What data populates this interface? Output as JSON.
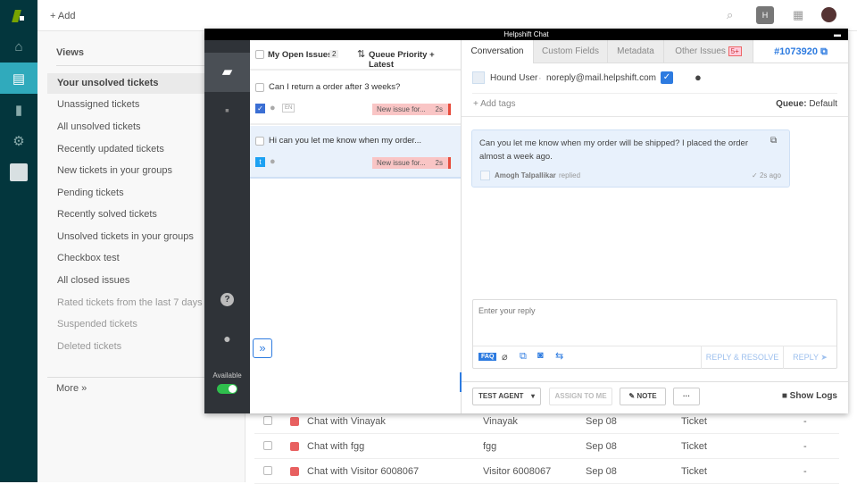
{
  "topbar": {
    "add_label": "+ Add"
  },
  "views": {
    "title": "Views",
    "items": [
      "Your unsolved tickets",
      "Unassigned tickets",
      "All unsolved tickets",
      "Recently updated tickets",
      "New tickets in your groups",
      "Pending tickets",
      "Recently solved tickets",
      "Unsolved tickets in your groups",
      "Checkbox test",
      "All closed issues",
      "Rated tickets from the last 7 days",
      "Suspended tickets",
      "Deleted tickets"
    ],
    "more": "More »"
  },
  "tickets": [
    {
      "subject": "Chat with Vinayak",
      "requester": "Vinayak",
      "date": "Sep 08",
      "type": "Ticket",
      "extra": "-"
    },
    {
      "subject": "Chat with fgg",
      "requester": "fgg",
      "date": "Sep 08",
      "type": "Ticket",
      "extra": "-"
    },
    {
      "subject": "Chat with Visitor 6008067",
      "requester": "Visitor 6008067",
      "date": "Sep 08",
      "type": "Ticket",
      "extra": "-"
    }
  ],
  "chat": {
    "title": "Helpshift Chat",
    "rail": {
      "available_label": "Available",
      "available": true
    },
    "list": {
      "my_open_label": "My Open Issues",
      "my_open_count": "2",
      "sort_label": "Queue Priority + Latest",
      "issues": [
        {
          "title": "Can I return a order after 3 weeks?",
          "lang": "EN",
          "status": "New issue for...",
          "age": "2s"
        },
        {
          "title": "Hi can you let me know when my order...",
          "status": "New issue for...",
          "age": "2s"
        }
      ]
    },
    "tabs": [
      "Conversation",
      "Custom Fields",
      "Metadata",
      "Other Issues"
    ],
    "other_issues_badge": "5+",
    "issue_id": "#1073920",
    "user_name": "Hound User",
    "user_email": "noreply@mail.helpshift.com",
    "add_tags": "+ Add tags",
    "queue_label": "Queue:",
    "queue_value": "Default",
    "message": {
      "text": "Can you let me know when my order will be shipped? I placed the order almost a week ago.",
      "author": "Amogh Talpallikar",
      "action": "replied",
      "time": "✓ 2s ago"
    },
    "reply_placeholder": "Enter your reply",
    "faq": "FAQ",
    "reply_resolve": "REPLY & RESOLVE",
    "reply": "REPLY",
    "agent": "TEST AGENT",
    "assign": "ASSIGN TO ME",
    "note": "NOTE",
    "more": "···",
    "show_logs": "Show Logs"
  }
}
